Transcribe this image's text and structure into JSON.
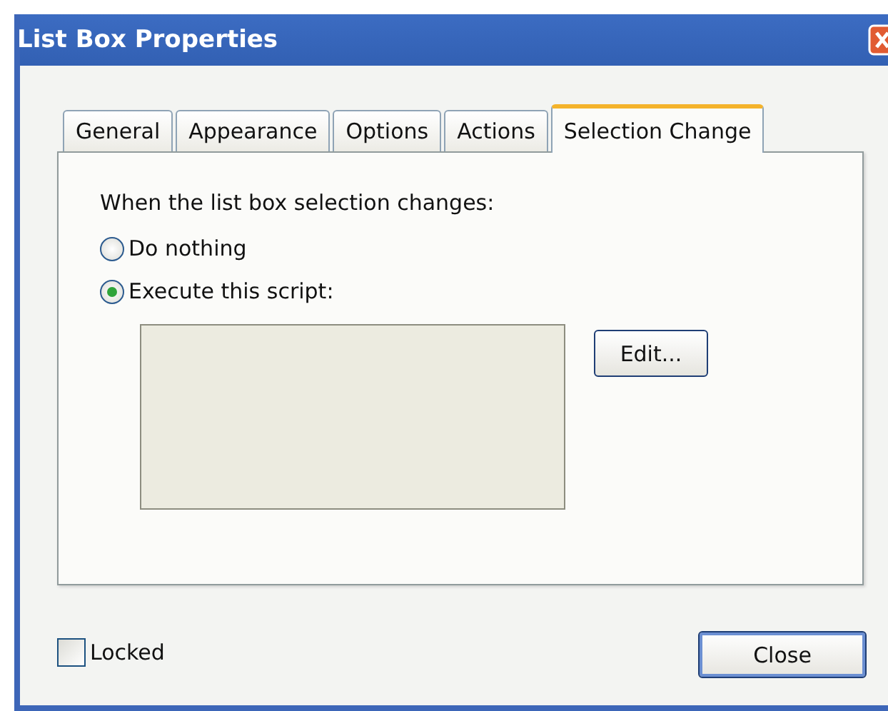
{
  "window": {
    "title": "List Box Properties"
  },
  "tabs": [
    {
      "label": "General",
      "selected": false
    },
    {
      "label": "Appearance",
      "selected": false
    },
    {
      "label": "Options",
      "selected": false
    },
    {
      "label": "Actions",
      "selected": false
    },
    {
      "label": "Selection Change",
      "selected": true
    }
  ],
  "prompt": "When the list box selection changes:",
  "options": [
    {
      "label": "Do nothing",
      "selected": false
    },
    {
      "label": "Execute this script:",
      "selected": true
    }
  ],
  "edit_button": "Edit...",
  "locked": {
    "label": "Locked",
    "checked": false
  },
  "close_button": "Close"
}
